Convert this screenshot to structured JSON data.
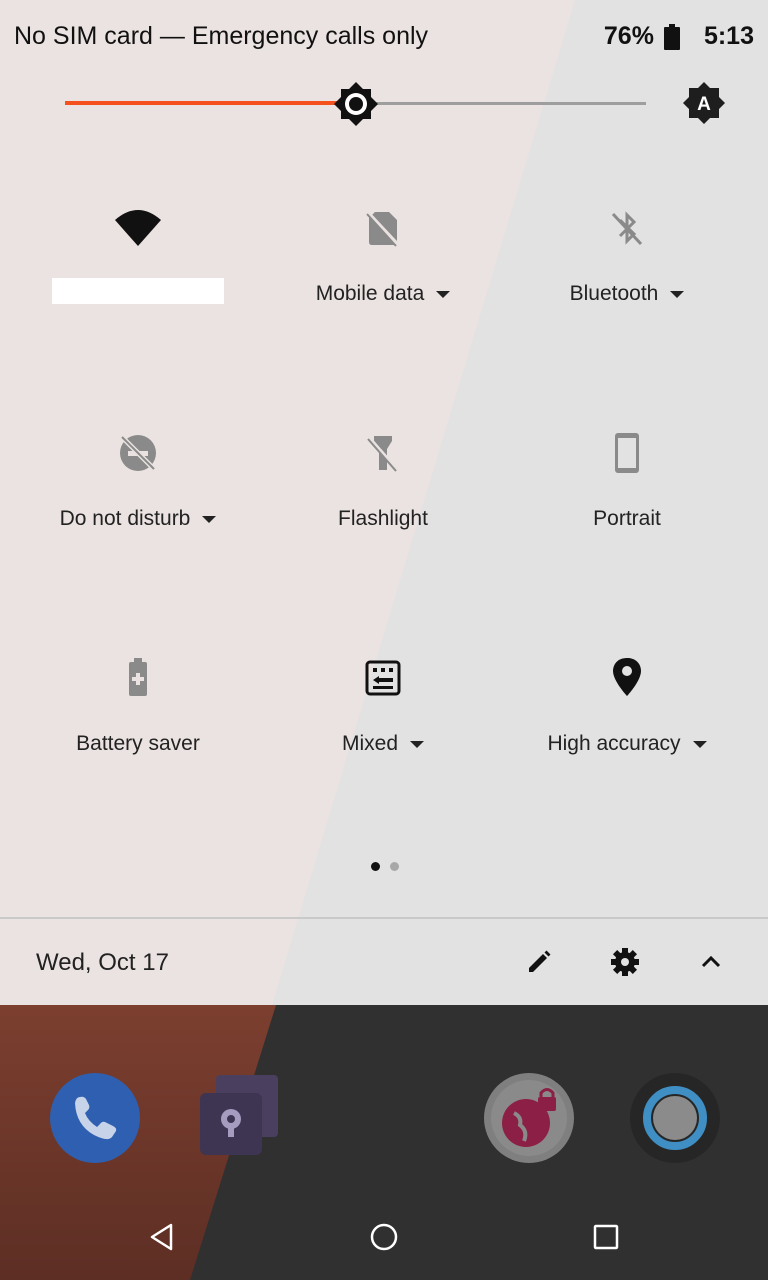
{
  "status_bar": {
    "carrier_text": "No SIM card — Emergency calls only",
    "battery": "76%",
    "time": "5:13"
  },
  "brightness": {
    "level": 0.5,
    "accent": "#f4511e",
    "auto_icon": "auto-brightness-icon"
  },
  "tiles": [
    {
      "id": "wifi",
      "label": "",
      "icon": "wifi-icon",
      "has_menu": false,
      "active": true
    },
    {
      "id": "mobile-data",
      "label": "Mobile data",
      "icon": "sim-off-icon",
      "has_menu": true,
      "active": false
    },
    {
      "id": "bluetooth",
      "label": "Bluetooth",
      "icon": "bluetooth-off-icon",
      "has_menu": true,
      "active": false
    },
    {
      "id": "dnd",
      "label": "Do not disturb",
      "icon": "dnd-off-icon",
      "has_menu": true,
      "active": false
    },
    {
      "id": "flashlight",
      "label": "Flashlight",
      "icon": "flashlight-off-icon",
      "has_menu": false,
      "active": false
    },
    {
      "id": "portrait",
      "label": "Portrait",
      "icon": "phone-portrait-icon",
      "has_menu": false,
      "active": false
    },
    {
      "id": "battery-saver",
      "label": "Battery saver",
      "icon": "battery-saver-icon",
      "has_menu": false,
      "active": false
    },
    {
      "id": "mixed",
      "label": "Mixed",
      "icon": "keyboard-icon",
      "has_menu": true,
      "active": true
    },
    {
      "id": "location",
      "label": "High accuracy",
      "icon": "location-icon",
      "has_menu": true,
      "active": true
    }
  ],
  "page_indicator": {
    "current": 1,
    "total": 2
  },
  "footer": {
    "date": "Wed, Oct 17",
    "edit_icon": "pencil-icon",
    "settings_icon": "gear-icon",
    "collapse_icon": "chevron-up-icon"
  },
  "home_apps": [
    "phone-app-icon",
    "secure-folder-icon",
    "secure-browser-icon",
    "assistant-icon"
  ],
  "nav": [
    "back-icon",
    "home-icon",
    "recents-icon"
  ]
}
